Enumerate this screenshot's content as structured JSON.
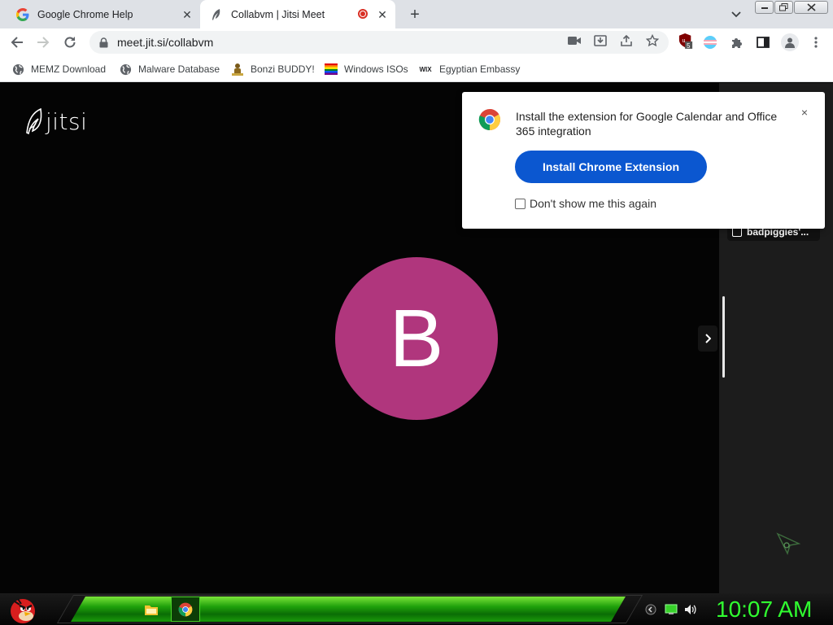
{
  "tabs": [
    {
      "title": "Google Chrome Help",
      "icon": "google-g-icon"
    },
    {
      "title": "Collabvm | Jitsi Meet",
      "icon": "jitsi-feather-icon",
      "recording": true
    }
  ],
  "window_controls": {
    "minimize": "minimize",
    "restore": "restore",
    "close": "close"
  },
  "toolbar": {
    "url": "meet.jit.si/collabvm",
    "extension_badge": "5"
  },
  "bookmarks": [
    {
      "label": "MEMZ Download",
      "icon": "globe-icon"
    },
    {
      "label": "Malware Database",
      "icon": "globe-icon"
    },
    {
      "label": "Bonzi BUDDY!",
      "icon": "bonzi-icon"
    },
    {
      "label": "Windows ISOs",
      "icon": "rainbow-flag-icon"
    },
    {
      "label": "Egyptian Embassy",
      "icon": "wix-icon",
      "icon_text": "WIX"
    }
  ],
  "meeting": {
    "logo": "jitsi",
    "avatar_letter": "B",
    "avatar_color": "#b0367d",
    "participant_name": "badpiggies'..."
  },
  "popup": {
    "message": "Install the extension for Google Calendar and Office 365 integration",
    "install_button": "Install Chrome Extension",
    "checkbox_label": "Don't show me this again",
    "close": "×"
  },
  "taskbar": {
    "clock": "10:07 AM",
    "accent": "#30ff30"
  }
}
